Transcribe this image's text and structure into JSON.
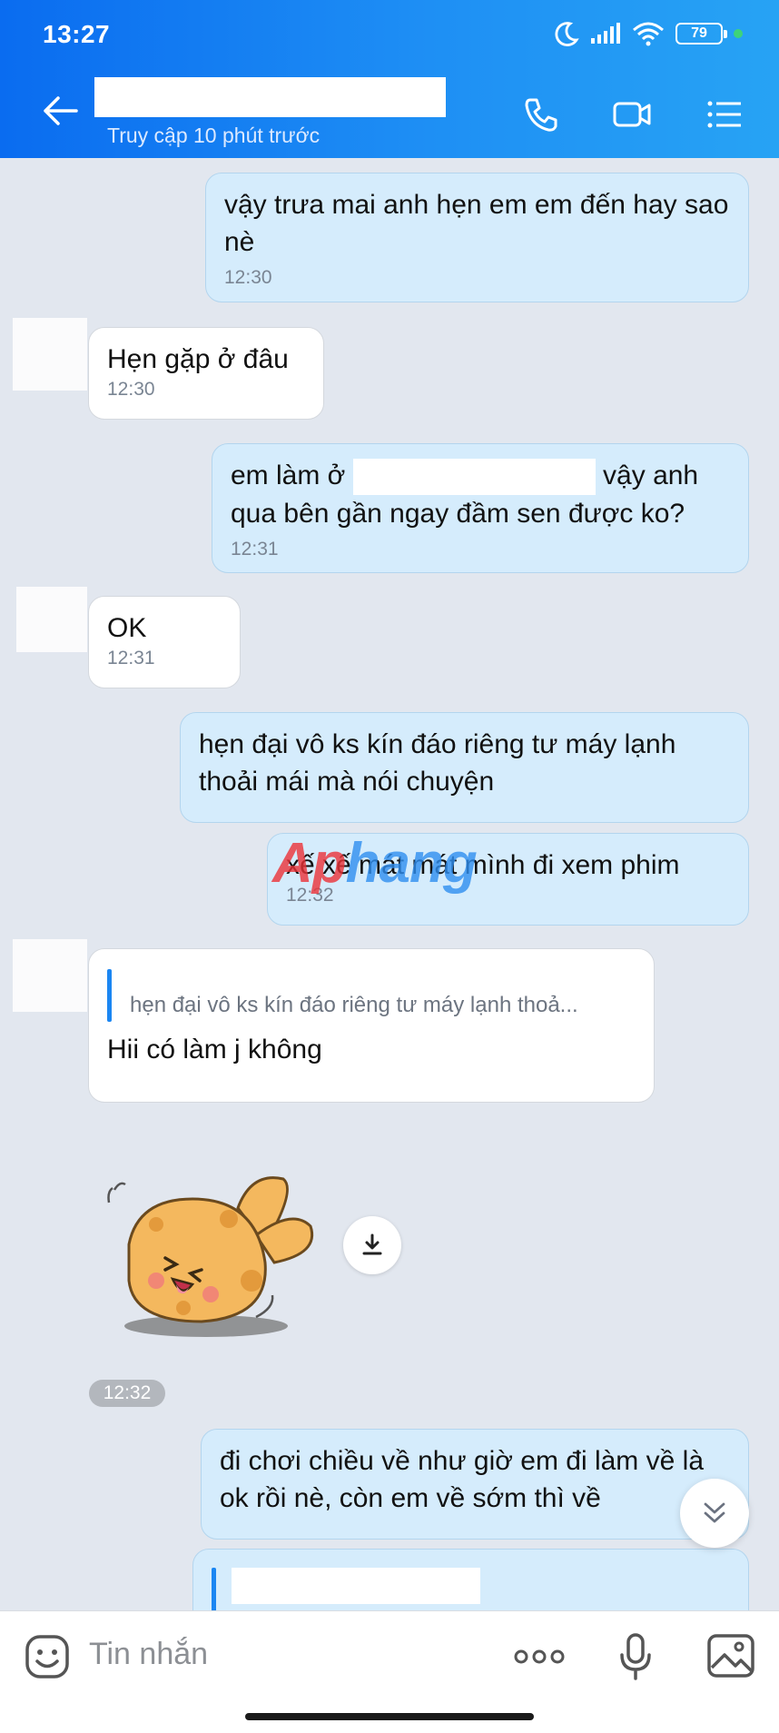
{
  "status_bar": {
    "time": "13:27",
    "battery": "79"
  },
  "header": {
    "last_seen": "Truy cập 10 phút trước"
  },
  "messages": [
    {
      "text": "vậy trưa mai anh hẹn em em đến hay sao nè",
      "time": "12:30"
    },
    {
      "text": "Hẹn gặp ở đâu",
      "time": "12:30"
    },
    {
      "text_before": "em làm ở",
      "text_after": "vậy anh",
      "text_line2": "qua bên gần ngay đầm sen được ko?",
      "time": "12:31"
    },
    {
      "text": "OK",
      "time": "12:31"
    },
    {
      "text": "hẹn đại vô ks kín đáo riêng tư máy lạnh thoải mái mà nói chuyện"
    },
    {
      "text": "xế xế mát mát mình đi xem phim",
      "time": "12:32"
    },
    {
      "quote": "hẹn đại vô ks kín đáo riêng tư máy lạnh thoả...",
      "text": "Hii có làm j không"
    },
    {
      "time": "12:32"
    },
    {
      "text": "đi chơi chiều về như giờ em đi làm về là ok rồi nè, còn em về sớm thì về"
    }
  ],
  "watermark": {
    "part1": "Ap",
    "part2": "hang"
  },
  "input": {
    "placeholder": "Tin nhắn"
  },
  "icons": {
    "back": "arrow-left-icon",
    "call": "phone-icon",
    "video": "video-camera-icon",
    "menu": "list-menu-icon",
    "emoji": "emoji-icon",
    "more": "more-dots-icon",
    "mic": "microphone-icon",
    "gallery": "image-icon",
    "download": "download-icon",
    "scroll": "chevron-double-down-icon"
  },
  "colors": {
    "header_start": "#0a6cf0",
    "header_end": "#27a3f4",
    "sent_bubble": "#d5ecfc",
    "received_bubble": "#ffffff",
    "background": "#e2e7ef"
  }
}
